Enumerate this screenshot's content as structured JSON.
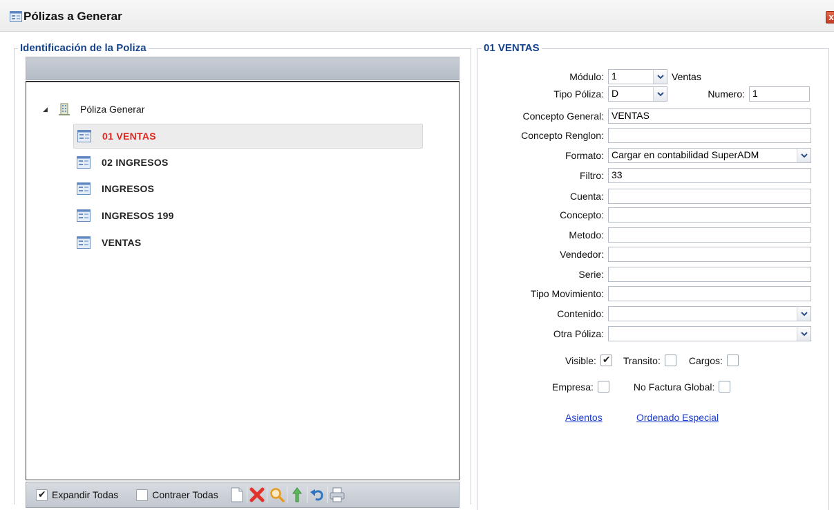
{
  "window": {
    "title": "Pólizas a Generar",
    "close_glyph": "x",
    "icon": "form-icon"
  },
  "left_panel": {
    "legend": "Identificación de la Poliza",
    "tree": {
      "root_label": "Póliza Generar",
      "root_icon": "building-icon",
      "expanded": true,
      "items": [
        {
          "label": "01 VENTAS",
          "selected": true
        },
        {
          "label": "02 INGRESOS",
          "selected": false
        },
        {
          "label": "INGRESOS",
          "selected": false
        },
        {
          "label": "INGRESOS 199",
          "selected": false
        },
        {
          "label": "VENTAS",
          "selected": false
        }
      ]
    },
    "toolbar": {
      "expand_all_label": "Expandir Todas",
      "expand_all_checked": true,
      "collapse_all_label": "Contraer Todas",
      "collapse_all_checked": false,
      "icons": [
        "new-document-icon",
        "delete-icon",
        "search-icon",
        "move-up-icon",
        "undo-icon",
        "print-icon"
      ]
    }
  },
  "right_panel": {
    "legend": "01 VENTAS",
    "modulo": {
      "label": "Módulo:",
      "value": "1",
      "description": "Ventas"
    },
    "tipo_poliza": {
      "label": "Tipo Póliza:",
      "value": "D"
    },
    "numero": {
      "label": "Numero:",
      "value": "1"
    },
    "concepto_general": {
      "label": "Concepto General:",
      "value": "VENTAS"
    },
    "concepto_renglon": {
      "label": "Concepto Renglon:",
      "value": ""
    },
    "formato": {
      "label": "Formato:",
      "value": "Cargar en contabilidad SuperADM"
    },
    "filtro": {
      "label": "Filtro:",
      "value": "33"
    },
    "cuenta": {
      "label": "Cuenta:",
      "value": ""
    },
    "concepto": {
      "label": "Concepto:",
      "value": ""
    },
    "metodo": {
      "label": "Metodo:",
      "value": ""
    },
    "vendedor": {
      "label": "Vendedor:",
      "value": ""
    },
    "serie": {
      "label": "Serie:",
      "value": ""
    },
    "tipo_movimiento": {
      "label": "Tipo Movimiento:",
      "value": ""
    },
    "contenido": {
      "label": "Contenido:",
      "value": ""
    },
    "otra_poliza": {
      "label": "Otra Póliza:",
      "value": ""
    },
    "checks": {
      "visible": {
        "label": "Visible:",
        "checked": true
      },
      "transito": {
        "label": "Transito:",
        "checked": false
      },
      "cargos": {
        "label": "Cargos:",
        "checked": false
      },
      "empresa": {
        "label": "Empresa:",
        "checked": false
      },
      "no_factura_global": {
        "label": "No Factura Global:",
        "checked": false
      }
    },
    "links": {
      "asientos": "Asientos",
      "ordenado_especial": "Ordenado Especial"
    }
  }
}
